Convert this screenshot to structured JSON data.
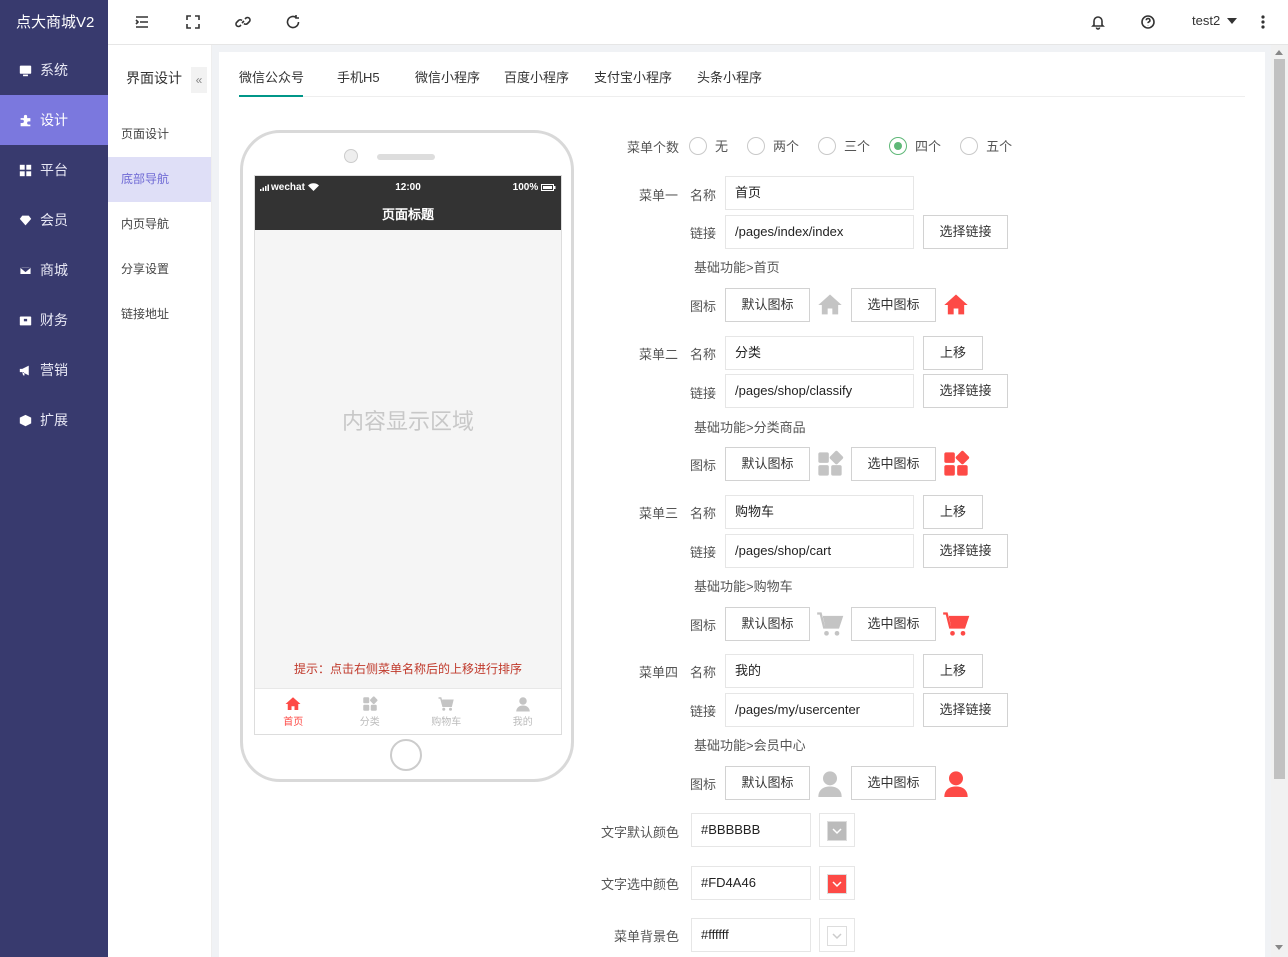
{
  "app": {
    "brand": "点大商城V2"
  },
  "sidebar": {
    "items": [
      {
        "label": "系统",
        "icon": "monitor-icon"
      },
      {
        "label": "设计",
        "icon": "puzzle-icon"
      },
      {
        "label": "平台",
        "icon": "grid-icon"
      },
      {
        "label": "会员",
        "icon": "diamond-icon"
      },
      {
        "label": "商城",
        "icon": "mail-icon"
      },
      {
        "label": "财务",
        "icon": "wallet-icon"
      },
      {
        "label": "营销",
        "icon": "megaphone-icon"
      },
      {
        "label": "扩展",
        "icon": "cube-icon"
      }
    ],
    "active_index": 1
  },
  "topbar": {
    "user": "test2"
  },
  "submenu": {
    "title": "界面设计",
    "collapse_label": "«",
    "items": [
      "页面设计",
      "底部导航",
      "内页导航",
      "分享设置",
      "链接地址"
    ],
    "active_index": 1
  },
  "tabs": [
    "微信公众号",
    "手机H5",
    "微信小程序",
    "百度小程序",
    "支付宝小程序",
    "头条小程序"
  ],
  "phone": {
    "carrier": "wechat",
    "time": "12:00",
    "battery": "100%",
    "page_title": "页面标题",
    "content_placeholder": "内容显示区域",
    "hint": "提示：点击右侧菜单名称后的上移进行排序",
    "tabbar": [
      {
        "label": "首页",
        "icon": "home-icon",
        "active": true
      },
      {
        "label": "分类",
        "icon": "category-icon",
        "active": false
      },
      {
        "label": "购物车",
        "icon": "cart-icon",
        "active": false
      },
      {
        "label": "我的",
        "icon": "user-icon",
        "active": false
      }
    ]
  },
  "form": {
    "menu_count_label": "菜单个数",
    "menu_count_options": [
      "无",
      "两个",
      "三个",
      "四个",
      "五个"
    ],
    "menu_count_selected": "四个",
    "name_label": "名称",
    "link_label": "链接",
    "icon_label": "图标",
    "select_link_label": "选择链接",
    "move_up_label": "上移",
    "default_icon_label": "默认图标",
    "selected_icon_label": "选中图标",
    "menus": [
      {
        "label": "菜单一",
        "name": "首页",
        "link": "/pages/index/index",
        "desc": "基础功能>首页",
        "icon": "home-icon"
      },
      {
        "label": "菜单二",
        "name": "分类",
        "link": "/pages/shop/classify",
        "desc": "基础功能>分类商品",
        "icon": "category-icon"
      },
      {
        "label": "菜单三",
        "name": "购物车",
        "link": "/pages/shop/cart",
        "desc": "基础功能>购物车",
        "icon": "cart-icon"
      },
      {
        "label": "菜单四",
        "name": "我的",
        "link": "/pages/my/usercenter",
        "desc": "基础功能>会员中心",
        "icon": "user-icon"
      }
    ],
    "text_default_color_label": "文字默认颜色",
    "text_default_color": "#BBBBBB",
    "text_selected_color_label": "文字选中颜色",
    "text_selected_color": "#FD4A46",
    "bg_color_label": "菜单背景色",
    "bg_color": "#ffffff"
  },
  "colors": {
    "sidebar_bg": "#383a6e",
    "sidebar_active": "#7b78de",
    "accent_red": "#fd4a46",
    "icon_gray": "#c4c4c4",
    "tab_underline": "#009688",
    "radio_green": "#5fb878"
  }
}
